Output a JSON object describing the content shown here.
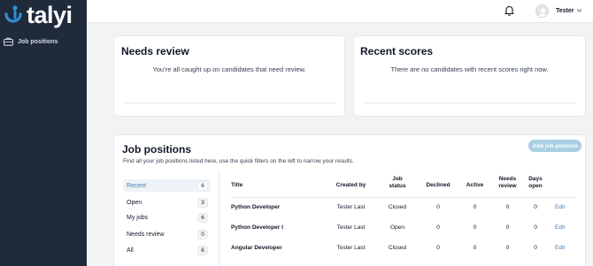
{
  "app": {
    "name": "talyi"
  },
  "sidebar": {
    "items": [
      {
        "label": "Job positions",
        "icon": "briefcase-icon"
      }
    ]
  },
  "header": {
    "user_name": "Tester"
  },
  "needs_review": {
    "title": "Needs review",
    "message": "You’re all caught up on candidates that need review."
  },
  "recent_scores": {
    "title": "Recent scores",
    "message": "There are no candidates with recent scores right now."
  },
  "job_positions": {
    "title": "Job positions",
    "subtitle": "Find all your job positions listed here, use the quick filters on the left to narrow your results.",
    "add_button": "Add job position",
    "filters": [
      {
        "label": "Recent",
        "count": "6"
      },
      {
        "label": "Open",
        "count": "3"
      },
      {
        "label": "My jobs",
        "count": "6"
      },
      {
        "label": "Needs review",
        "count": "0"
      },
      {
        "label": "All",
        "count": "6"
      }
    ],
    "columns": [
      {
        "label": "Title"
      },
      {
        "label": "Created by"
      },
      {
        "label": "Job\nstatus"
      },
      {
        "label": "Declined"
      },
      {
        "label": "Active"
      },
      {
        "label": "Needs\nreview"
      },
      {
        "label": "Days\nopen"
      }
    ],
    "rows": [
      {
        "title": "Python Developer",
        "created_by": "Tester Last",
        "status": "Closed",
        "declined": "0",
        "active": "0",
        "needs_review": "0",
        "days_open": "0",
        "action": "Edit"
      },
      {
        "title": "Python Developer I",
        "created_by": "Tester Last",
        "status": "Open",
        "declined": "0",
        "active": "0",
        "needs_review": "0",
        "days_open": "0",
        "action": "Edit"
      },
      {
        "title": "Angular Developer",
        "created_by": "Tester Last",
        "status": "Closed",
        "declined": "0",
        "active": "0",
        "needs_review": "0",
        "days_open": "0",
        "action": "Edit"
      }
    ]
  },
  "colors": {
    "sidebar": "#1f2a3b",
    "accent": "#4b7bb4",
    "button": "#a9cfe3",
    "logo_blue": "#2f8fd8"
  }
}
